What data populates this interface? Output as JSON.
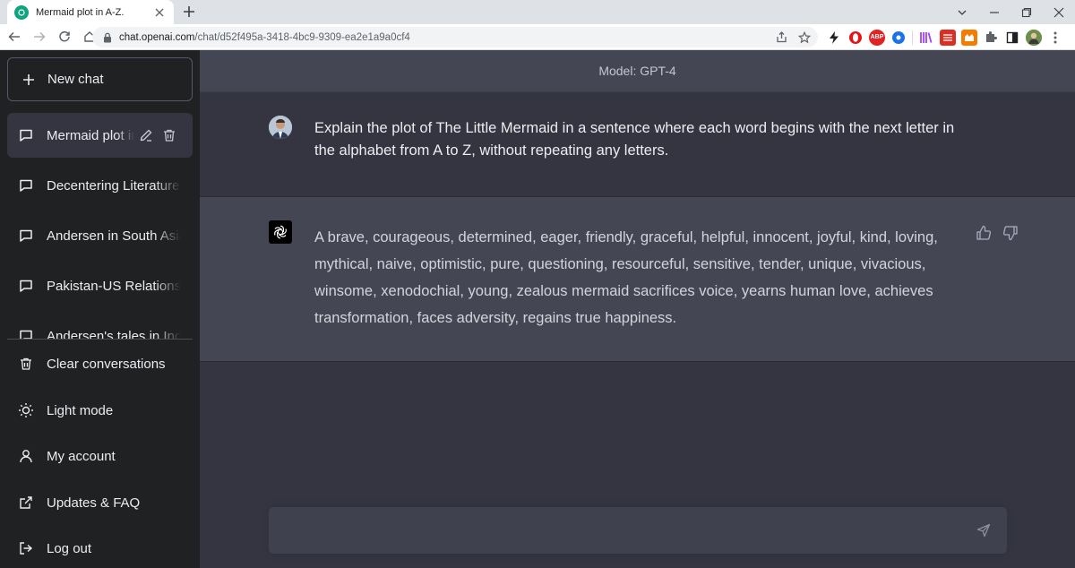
{
  "browser": {
    "tab_title": "Mermaid plot in A-Z.",
    "url_host": "chat.openai.com",
    "url_path": "/chat/d52f495a-3418-4bc9-9309-ea2e1a9a0cf4",
    "extensions": [
      {
        "name": "bolt-extension-icon",
        "text": "⚡",
        "color": "#ffffff"
      },
      {
        "name": "opera-extension-icon",
        "text": "O",
        "color": "#e3141b"
      },
      {
        "name": "adblock-extension-icon",
        "text": "ABP",
        "color": "#e32224"
      },
      {
        "name": "blue-extension-icon",
        "text": "●",
        "color": "#1a73e8"
      },
      {
        "name": "library-extension-icon",
        "text": "|||",
        "color": "#9c27b0"
      },
      {
        "name": "red-extension-icon",
        "text": "▦",
        "color": "#d93025"
      },
      {
        "name": "orange-extension-icon",
        "text": "▤",
        "color": "#f57c00"
      }
    ]
  },
  "sidebar": {
    "new_chat": "New chat",
    "conversations": [
      {
        "label": "Mermaid plot in A-Z.",
        "active": true
      },
      {
        "label": "Decentering Literature",
        "active": false
      },
      {
        "label": "Andersen in South Asia",
        "active": false
      },
      {
        "label": "Pakistan-US Relations",
        "active": false
      },
      {
        "label": "Andersen's tales in India",
        "active": false
      }
    ],
    "bottom": {
      "clear": "Clear conversations",
      "light_mode": "Light mode",
      "account": "My account",
      "updates": "Updates & FAQ",
      "logout": "Log out"
    }
  },
  "main": {
    "model_label": "Model: GPT-4",
    "user_message": "Explain the plot of The Little Mermaid in a sentence where each word begins with the next letter in the alphabet from A to Z, without repeating any letters.",
    "assistant_message": "A brave, courageous, determined, eager, friendly, graceful, helpful, innocent, joyful, kind, loving, mythical, naive, optimistic, pure, questioning, resourceful, sensitive, tender, unique, vivacious, winsome, xenodochial, young, zealous mermaid sacrifices voice, yearns human love, achieves transformation, faces adversity, regains true happiness.",
    "input_placeholder": ""
  },
  "colors": {
    "sidebar_bg": "#202123",
    "main_bg": "#343541",
    "assistant_bg": "#444654",
    "brand": "#10a37f"
  }
}
